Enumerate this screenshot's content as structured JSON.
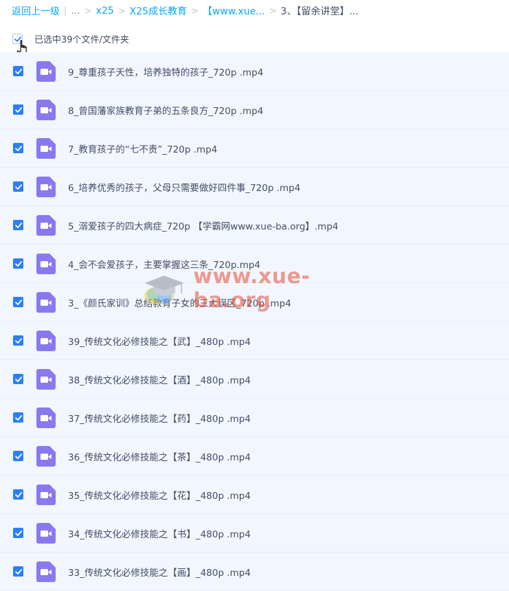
{
  "breadcrumb": {
    "back": "返回上一级",
    "divider": "|",
    "ellipsis": "...",
    "items": [
      "x25",
      "X25成长教育",
      "【www.xue...",
      "3、【留余讲堂】..."
    ],
    "separator": ">"
  },
  "selection": {
    "label": "已选中39个文件/文件夹"
  },
  "files": [
    "9_尊重孩子天性，培养独特的孩子_720p .mp4",
    "8_曾国藩家族教育子弟的五条良方_720p .mp4",
    "7_教育孩子的“七不责”_720p .mp4",
    "6_培养优秀的孩子，父母只需要做好四件事_720p .mp4",
    "5_溺爱孩子的四大病症_720p 【学霸网www.xue-ba.org】.mp4",
    "4_会不会爱孩子，主要掌握这三条_720p.mp4",
    "3_《颜氏家训》总结教育子女的三大误区_720p .mp4",
    "39_传统文化必修技能之【武】_480p .mp4",
    "38_传统文化必修技能之【酒】_480p .mp4",
    "37_传统文化必修技能之【药】_480p .mp4",
    "36_传统文化必修技能之【茶】_480p .mp4",
    "35_传统文化必修技能之【花】_480p .mp4",
    "34_传统文化必修技能之【书】_480p .mp4",
    "33_传统文化必修技能之【画】_480p .mp4"
  ],
  "watermark": "www.xue-ba.org",
  "colors": {
    "accent": "#06a7ff",
    "checkbox": "#2d7ef7",
    "video_icon": "#8a78ef",
    "row_bg": "#f2f7ff"
  }
}
